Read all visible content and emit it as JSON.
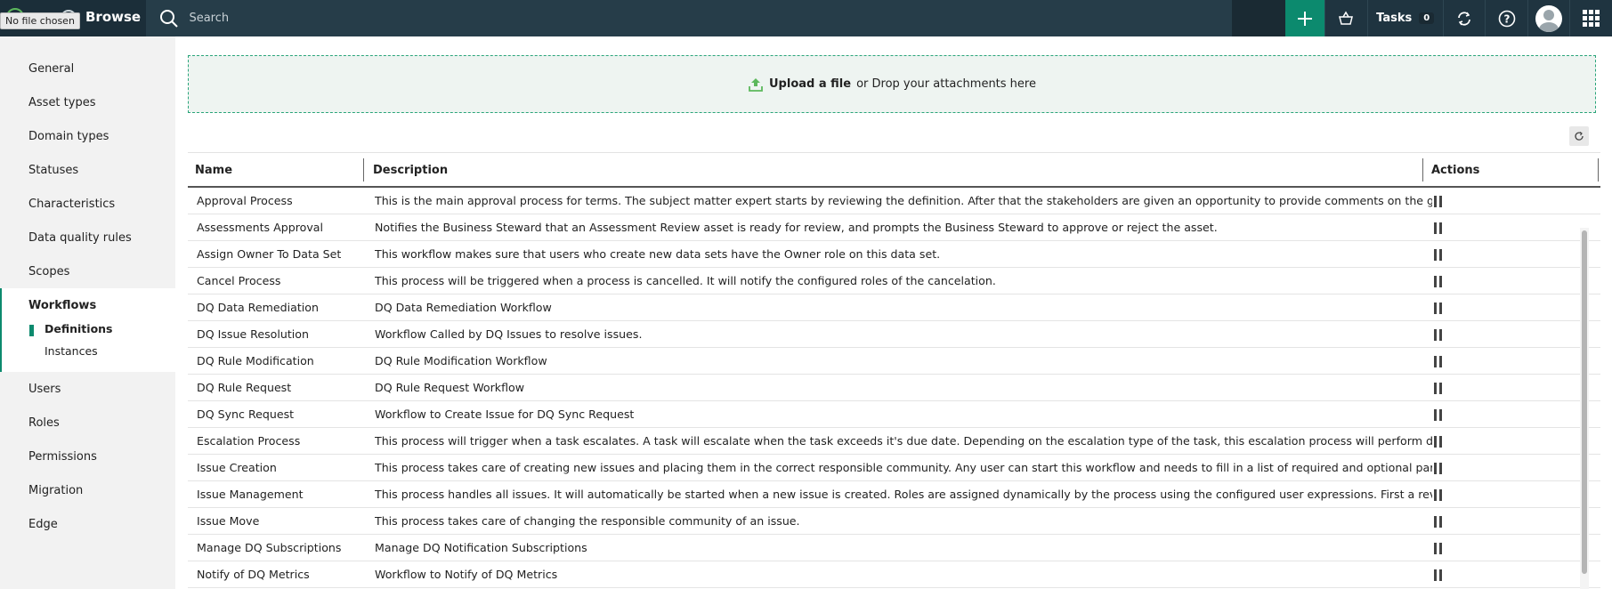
{
  "topbar": {
    "file_status": "No file chosen",
    "app_title": "Browse",
    "search_placeholder": "Search",
    "tasks_label": "Tasks",
    "tasks_count": "0",
    "accent_color": "#0c8a6e"
  },
  "sidebar": {
    "items_top": [
      "General",
      "Asset types",
      "Domain types",
      "Statuses",
      "Characteristics",
      "Data quality rules",
      "Scopes"
    ],
    "workflows": {
      "title": "Workflows",
      "definitions": "Definitions",
      "instances": "Instances"
    },
    "items_bottom": [
      "Users",
      "Roles",
      "Permissions",
      "Migration",
      "Edge"
    ]
  },
  "upload": {
    "link": "Upload a file",
    "text": "or Drop your attachments here"
  },
  "table": {
    "headers": {
      "name": "Name",
      "description": "Description",
      "actions": "Actions"
    },
    "rows": [
      {
        "name": "Approval Process",
        "description": "This is the main approval process for terms. The subject matter expert starts by reviewing the definition. After that the stakeholders are given an opportunity to provide comments on the given term. The subject m"
      },
      {
        "name": "Assessments Approval",
        "description": "Notifies the Business Steward that an Assessment Review asset is ready for review, and prompts the Business Steward to approve or reject the asset."
      },
      {
        "name": "Assign Owner To Data Set",
        "description": "This workflow makes sure that users who create new data sets have the Owner role on this data set."
      },
      {
        "name": "Cancel Process",
        "description": "This process will be triggered when a process is cancelled. It will notify the configured roles of the cancelation."
      },
      {
        "name": "DQ Data Remediation",
        "description": "DQ Data Remediation Workflow"
      },
      {
        "name": "DQ Issue Resolution",
        "description": "Workflow Called by DQ Issues to resolve issues."
      },
      {
        "name": "DQ Rule Modification",
        "description": "DQ Rule Modification Workflow"
      },
      {
        "name": "DQ Rule Request",
        "description": "DQ Rule Request Workflow"
      },
      {
        "name": "DQ Sync Request",
        "description": "Workflow to Create Issue for DQ Sync Request"
      },
      {
        "name": "Escalation Process",
        "description": "This process will trigger when a task escalates. A task will escalate when the task exceeds it's due date. Depending on the escalation type of the task, this escalation process will perform different logic. Two escalati"
      },
      {
        "name": "Issue Creation",
        "description": "This process takes care of creating new issues and placing them in the correct responsible community. Any user can start this workflow and needs to fill in a list of required and optional parameters for the issue to"
      },
      {
        "name": "Issue Management",
        "description": "This process handles all issues. It will automatically be started when a new issue is created. Roles are assigned dynamically by the process using the configured user expressions. First a reviewer can accept to do th"
      },
      {
        "name": "Issue Move",
        "description": "This process takes care of changing the responsible community of an issue."
      },
      {
        "name": "Manage DQ Subscriptions",
        "description": "Manage DQ Notification Subscriptions"
      },
      {
        "name": "Notify of DQ Metrics",
        "description": "Workflow to Notify of DQ Metrics"
      }
    ]
  }
}
